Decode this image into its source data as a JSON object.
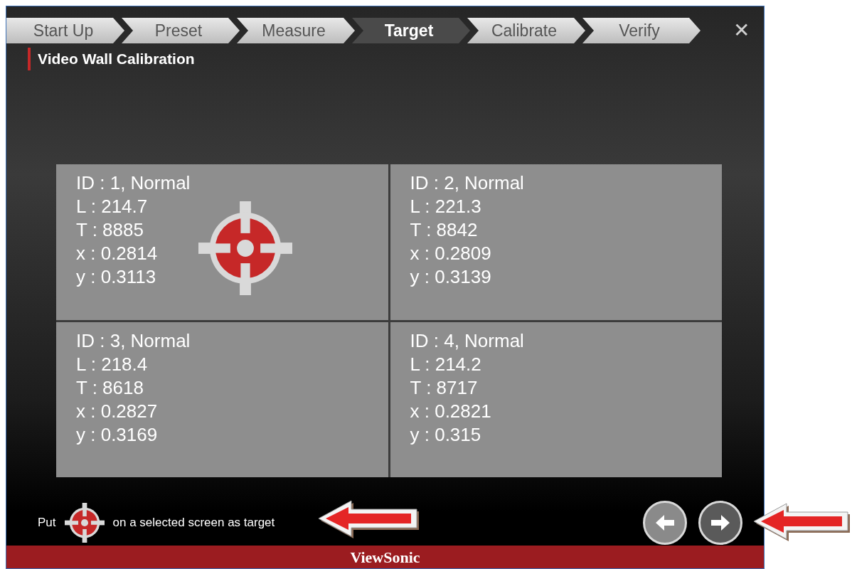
{
  "steps": [
    {
      "label": "Start Up",
      "selected": false
    },
    {
      "label": "Preset",
      "selected": false
    },
    {
      "label": "Measure",
      "selected": false
    },
    {
      "label": "Target",
      "selected": true
    },
    {
      "label": "Calibrate",
      "selected": false
    },
    {
      "label": "Verify",
      "selected": false
    }
  ],
  "close": "✕",
  "title": "Video Wall Calibration",
  "screens": [
    {
      "lines": [
        "ID : 1, Normal",
        "L : 214.7",
        "T : 8885",
        "x : 0.2814",
        "y : 0.3113"
      ],
      "target": true
    },
    {
      "lines": [
        "ID : 2, Normal",
        "L : 221.3",
        "T : 8842",
        "x : 0.2809",
        "y : 0.3139"
      ],
      "target": false
    },
    {
      "lines": [
        "ID : 3, Normal",
        "L : 218.4",
        "T : 8618",
        "x : 0.2827",
        "y : 0.3169"
      ],
      "target": false
    },
    {
      "lines": [
        "ID : 4, Normal",
        "L : 214.2",
        "T : 8717",
        "x : 0.2821",
        "y : 0.315"
      ],
      "target": false
    }
  ],
  "hint": {
    "before": "Put",
    "after": "on a selected screen as target"
  },
  "brand": "ViewSonic"
}
